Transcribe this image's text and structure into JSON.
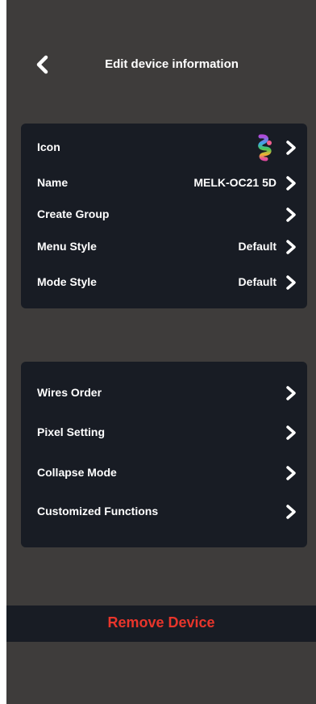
{
  "header": {
    "title": "Edit device information",
    "back_icon": "chevron-left-icon"
  },
  "general_section": {
    "items": [
      {
        "label": "Icon",
        "value": "",
        "icon": "device-style-icon"
      },
      {
        "label": "Name",
        "value": "MELK-OC21 5D"
      },
      {
        "label": "Create Group",
        "value": ""
      },
      {
        "label": "Menu Style",
        "value": "Default"
      },
      {
        "label": "Mode Style",
        "value": "Default"
      }
    ]
  },
  "settings_section": {
    "items": [
      {
        "label": "Wires Order"
      },
      {
        "label": "Pixel Setting"
      },
      {
        "label": "Collapse Mode"
      },
      {
        "label": "Customized Functions"
      }
    ]
  },
  "remove_button": {
    "label": "Remove Device"
  },
  "colors": {
    "background": "#3e3c3b",
    "card": "#181c24",
    "text": "#ffffff",
    "danger": "#e8352b"
  }
}
